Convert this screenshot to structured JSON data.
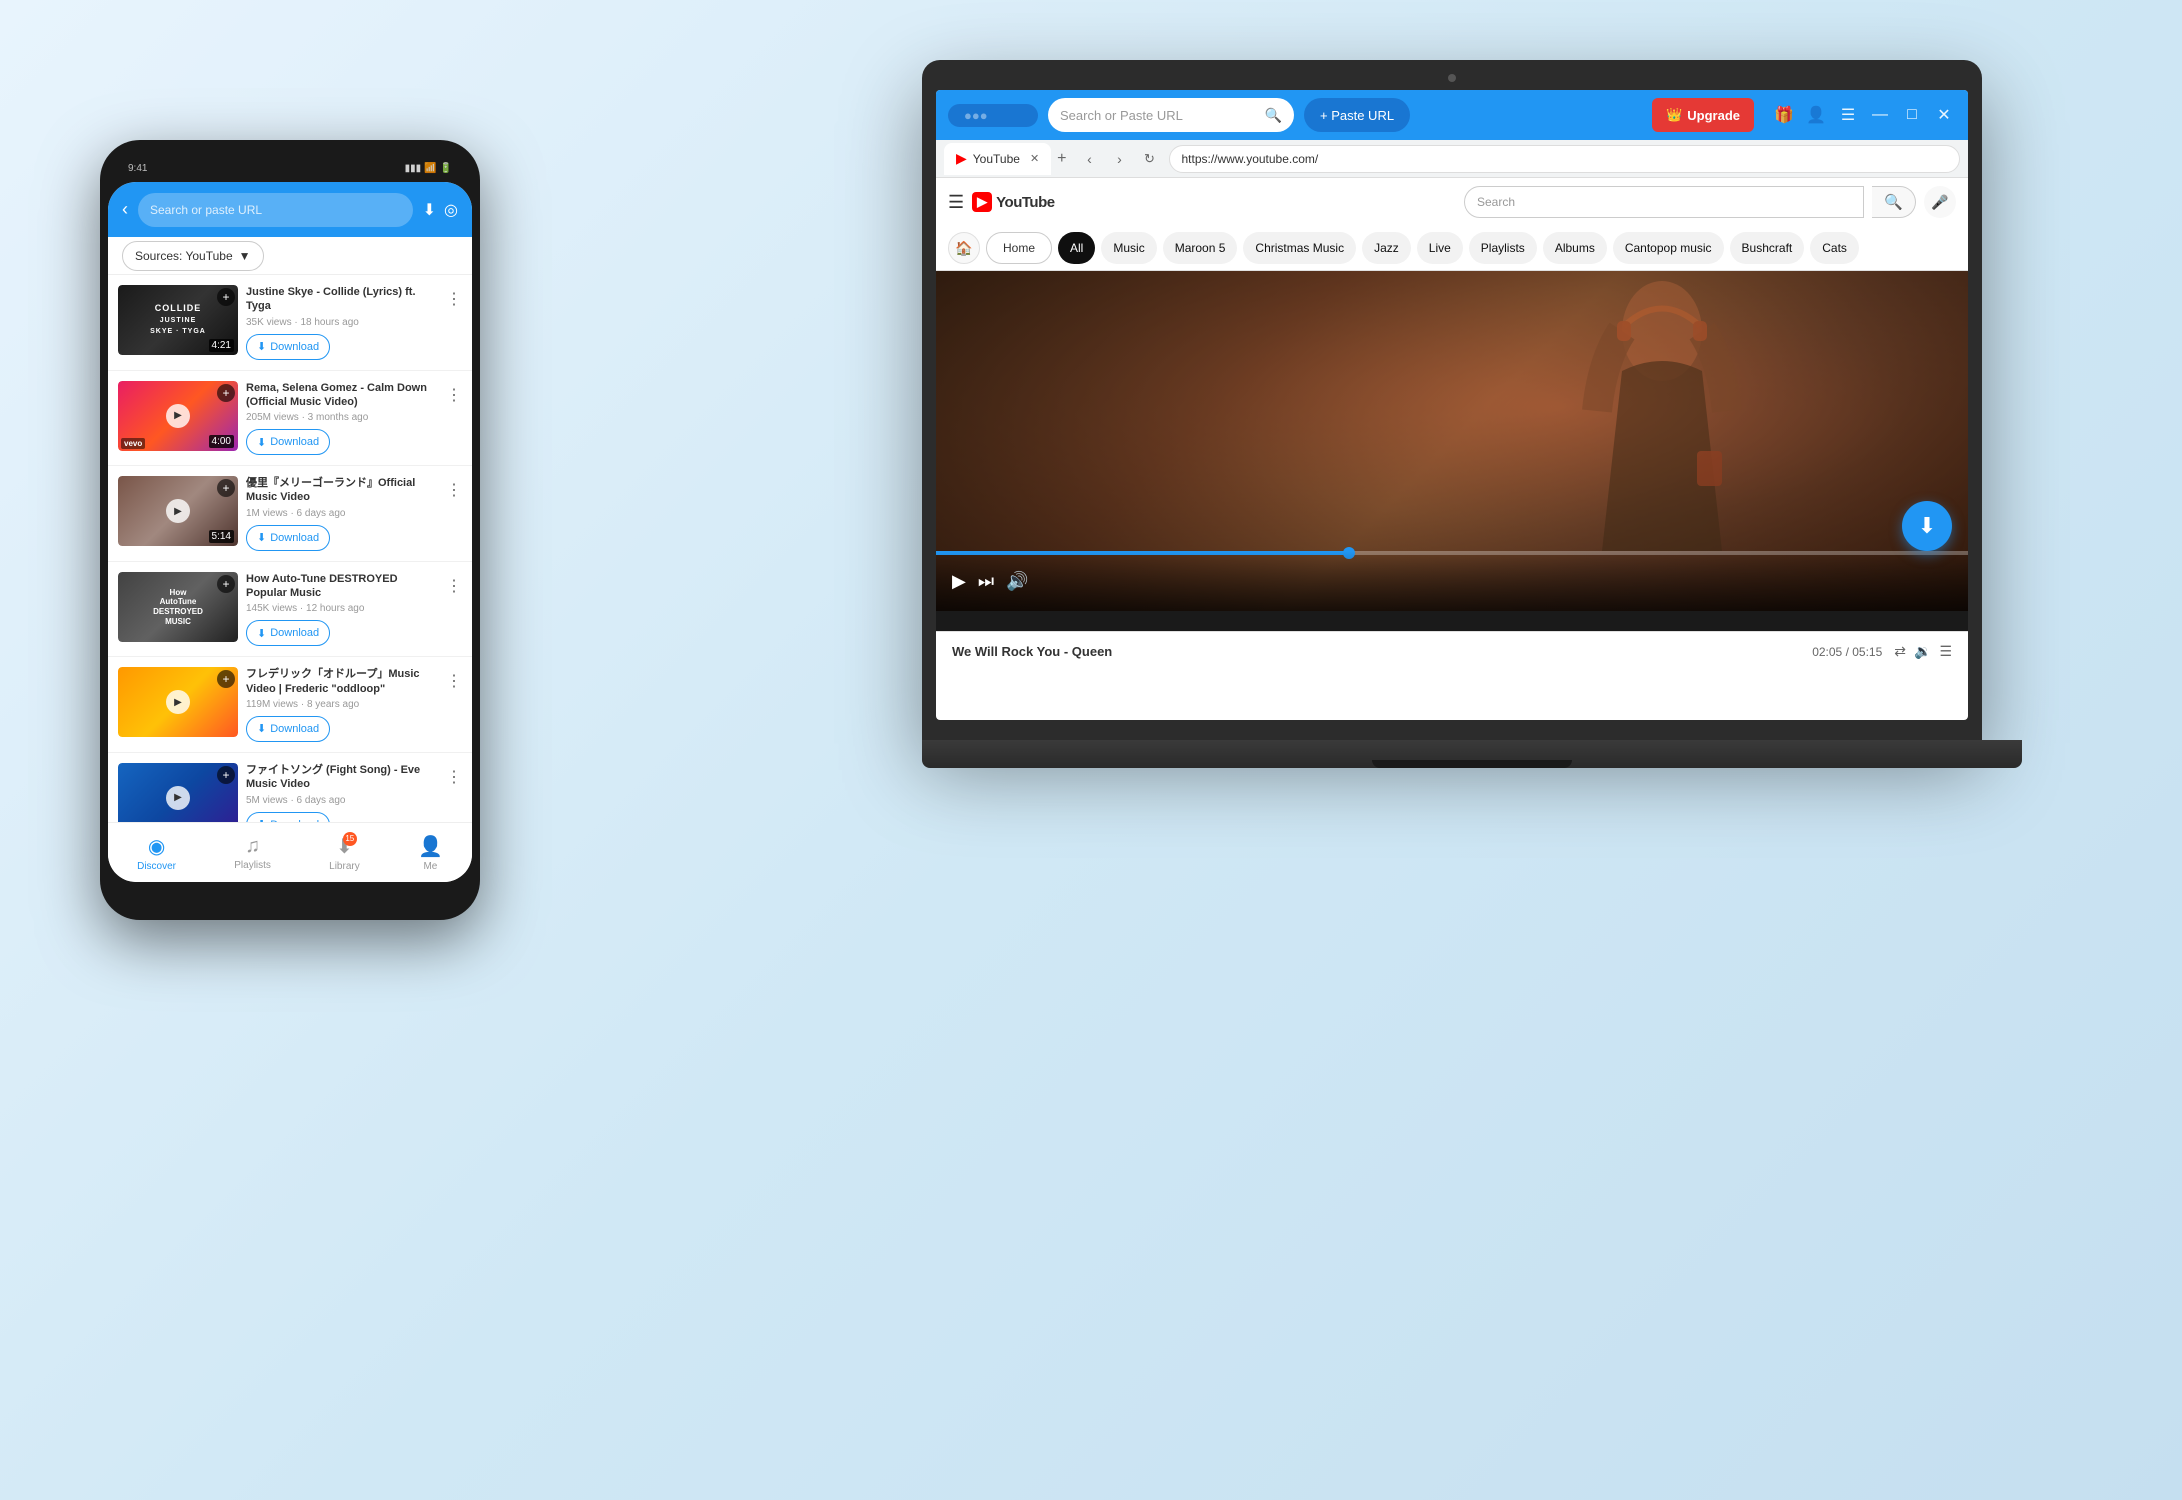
{
  "laptop": {
    "titlebar": {
      "logo_placeholder": "●●●",
      "search_placeholder": "Search or Paste URL",
      "paste_url_label": "+ Paste URL",
      "upgrade_label": "Upgrade",
      "gift_icon": "🎁",
      "user_icon": "👤",
      "menu_icon": "☰",
      "minimize_icon": "—",
      "maximize_icon": "□",
      "close_icon": "✕"
    },
    "browser": {
      "tab_title": "YouTube",
      "tab_close": "✕",
      "tab_add": "+",
      "nav_back": "‹",
      "nav_forward": "›",
      "nav_refresh": "↻",
      "url": "https://www.youtube.com/"
    },
    "youtube": {
      "hamburger": "☰",
      "logo_text": "YouTube",
      "search_placeholder": "Search",
      "chips": [
        {
          "label": "All",
          "active": true
        },
        {
          "label": "Music",
          "active": false
        },
        {
          "label": "Maroon 5",
          "active": false
        },
        {
          "label": "Christmas Music",
          "active": false
        },
        {
          "label": "Jazz",
          "active": false
        },
        {
          "label": "Live",
          "active": false
        },
        {
          "label": "Playlists",
          "active": false
        },
        {
          "label": "Albums",
          "active": false
        },
        {
          "label": "Cantopop music",
          "active": false
        },
        {
          "label": "Bushcraft",
          "active": false
        },
        {
          "label": "Cats",
          "active": false
        }
      ],
      "home_label": "Home",
      "play_icon": "▶",
      "skip_icon": "⏭",
      "volume_icon": "🔊",
      "now_playing": "We Will Rock You - Queen",
      "time_current": "02:05",
      "time_total": "05:15",
      "shuffle_icon": "⇄",
      "volume_icon2": "🔉",
      "queue_icon": "☰",
      "progress_percent": 40
    }
  },
  "phone": {
    "header": {
      "back_icon": "‹",
      "search_placeholder": "Search or paste URL",
      "download_icon": "⬇",
      "discover_icon": "◎"
    },
    "sources": {
      "label": "Sources: YouTube",
      "dropdown_icon": "▼"
    },
    "videos": [
      {
        "title": "Justine Skye - Collide (Lyrics) ft. Tyga",
        "meta": "35K views · 18 hours ago",
        "duration": "4:21",
        "download_label": "Download",
        "thumb_class": "thumb-collide",
        "collide_text": "COLLIDE"
      },
      {
        "title": "Rema, Selena Gomez - Calm Down (Official Music Video)",
        "meta": "205M views · 3 months ago",
        "duration": "4:00",
        "download_label": "Download",
        "thumb_class": "thumb-calm"
      },
      {
        "title": "優里『メリーゴーランド』Official Music Video",
        "meta": "1M views · 6 days ago",
        "duration": "5:14",
        "download_label": "Download",
        "thumb_class": "thumb-merry"
      },
      {
        "title": "How Auto-Tune DESTROYED Popular Music",
        "meta": "145K views · 12 hours ago",
        "duration": "",
        "download_label": "Download",
        "thumb_class": "thumb-autotune",
        "autotune_text": "How AutoTune DESTROYED MUSIC"
      },
      {
        "title": "フレデリック「オドループ」Music Video | Frederic \"oddloop\"",
        "meta": "119M views · 8 years ago",
        "duration": "",
        "download_label": "Download",
        "thumb_class": "thumb-oddloop"
      },
      {
        "title": "ファイトソング (Fight Song) - Eve Music Video",
        "meta": "5M views · 6 days ago",
        "duration": "",
        "download_label": "Download",
        "thumb_class": "thumb-fight"
      }
    ],
    "bottom_nav": [
      {
        "label": "Discover",
        "icon": "◎",
        "active": true
      },
      {
        "label": "Playlists",
        "icon": "♫",
        "active": false
      },
      {
        "label": "Library",
        "icon": "⬇",
        "active": false,
        "badge": "15"
      },
      {
        "label": "Me",
        "icon": "👤",
        "active": false
      }
    ]
  },
  "colors": {
    "primary": "#2196f3",
    "upgrade_red": "#e53935",
    "download_blue": "#2196f3",
    "text_dark": "#333333",
    "text_light": "#999999"
  }
}
